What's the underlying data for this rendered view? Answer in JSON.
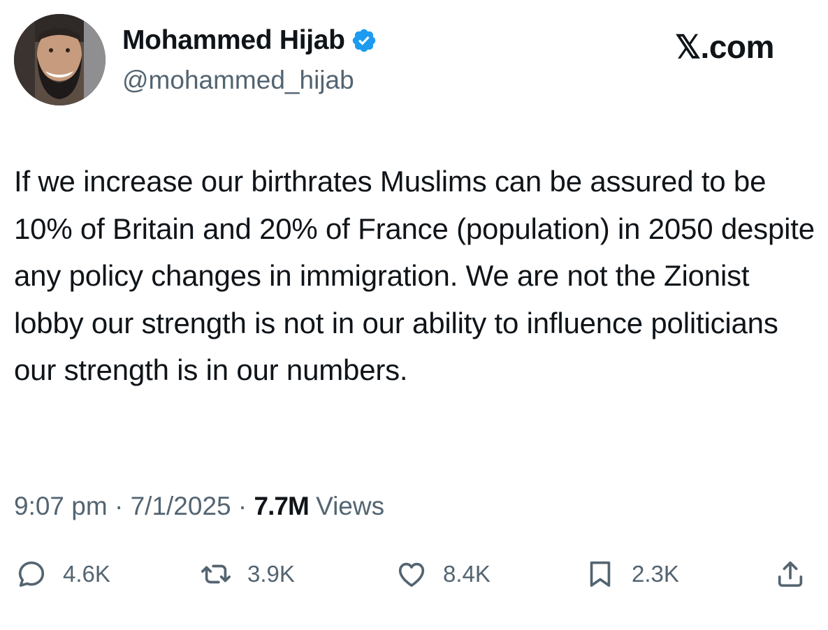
{
  "author": {
    "display_name": "Mohammed Hijab",
    "handle": "@mohammed_hijab",
    "verified_icon": "verified-badge-icon",
    "badge_color": "#1d9bf0"
  },
  "brand": "𝕏.com",
  "tweet": {
    "text": "If we increase our birthrates Muslims can be assured to be 10% of Britain and 20% of France (population) in 2050 despite any policy changes in immigration. We are not the Zionist lobby our strength is not in our ability to influence politicians our strength is in our numbers."
  },
  "meta": {
    "time": "9:07 pm",
    "separator": " · ",
    "date": "7/1/2025",
    "views_count": "7.7M",
    "views_label": "Views"
  },
  "actions": {
    "replies": "4.6K",
    "reposts": "3.9K",
    "likes": "8.4K",
    "bookmarks": "2.3K"
  },
  "colors": {
    "text": "#0f1419",
    "secondary": "#536471"
  }
}
